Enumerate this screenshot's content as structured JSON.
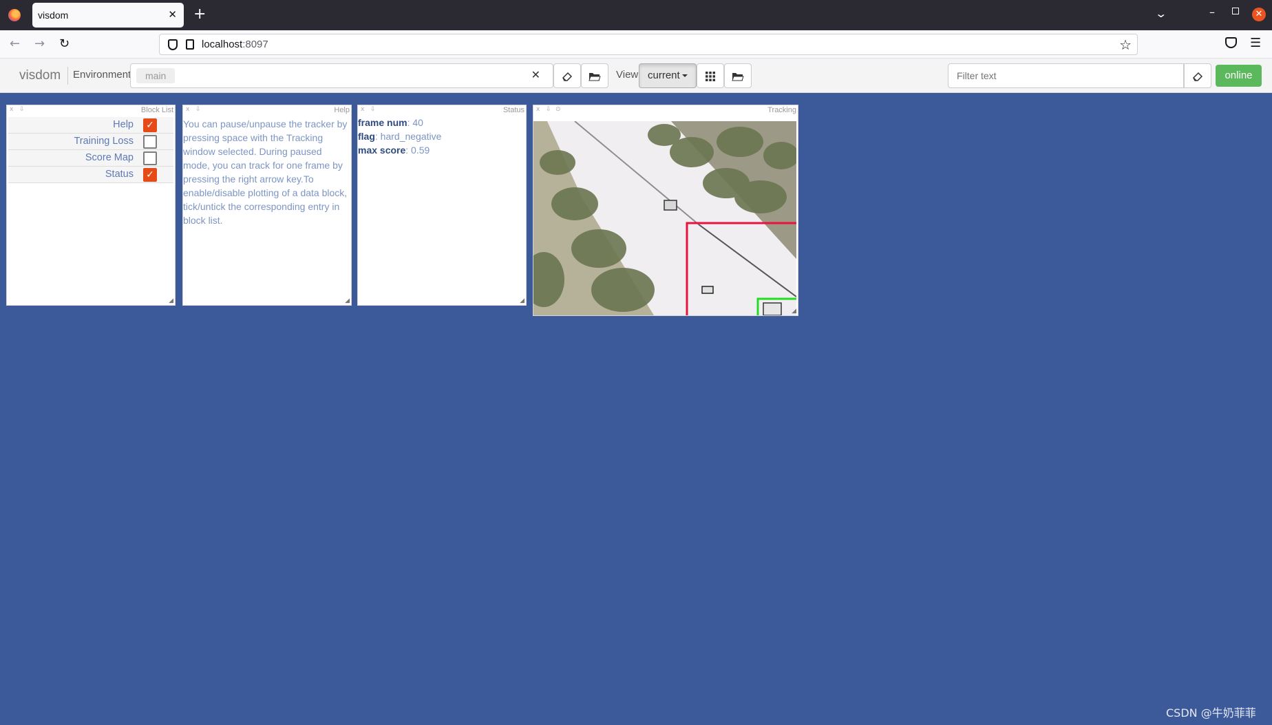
{
  "browser": {
    "tab_title": "visdom",
    "tab_close": "✕",
    "new_tab": "+",
    "url_host": "localhost",
    "url_port": ":8097"
  },
  "toolbar": {
    "brand": "visdom",
    "environment_label": "Environment",
    "environment_value": "main",
    "view_label": "View",
    "view_value": "current",
    "filter_placeholder": "Filter text",
    "status_button": "online"
  },
  "panes": {
    "block_list": {
      "title": "Block List",
      "items": [
        {
          "label": "Help",
          "checked": true
        },
        {
          "label": "Training Loss",
          "checked": false
        },
        {
          "label": "Score Map",
          "checked": false
        },
        {
          "label": "Status",
          "checked": true
        }
      ]
    },
    "help": {
      "title": "Help",
      "text": "You can pause/unpause the tracker by pressing space with the Tracking window selected. During paused mode, you can track for one frame by pressing the right arrow key.To enable/disable plotting of a data block, tick/untick the corresponding entry in block list."
    },
    "status": {
      "title": "Status",
      "lines": [
        {
          "key": "frame num",
          "value": ": 40"
        },
        {
          "key": "flag",
          "value": ": hard_negative"
        },
        {
          "key": "max score",
          "value": ": 0.59"
        }
      ]
    },
    "tracking": {
      "title": "Tracking"
    }
  },
  "watermark": "CSDN @牛奶菲菲",
  "colors": {
    "page_background": "#3c5a9a",
    "checkbox_checked": "#e64a19",
    "online_green": "#5cb85c",
    "box_red": "#e8123c",
    "box_green": "#22dd22"
  },
  "icons": [
    "firefox-logo-icon",
    "back-arrow-icon",
    "forward-arrow-icon",
    "reload-icon",
    "shield-icon",
    "page-icon",
    "star-icon",
    "pocket-icon",
    "menu-icon",
    "eraser-icon",
    "folder-icon",
    "grid-icon",
    "close-icon",
    "checkmark-icon",
    "resize-icon"
  ]
}
